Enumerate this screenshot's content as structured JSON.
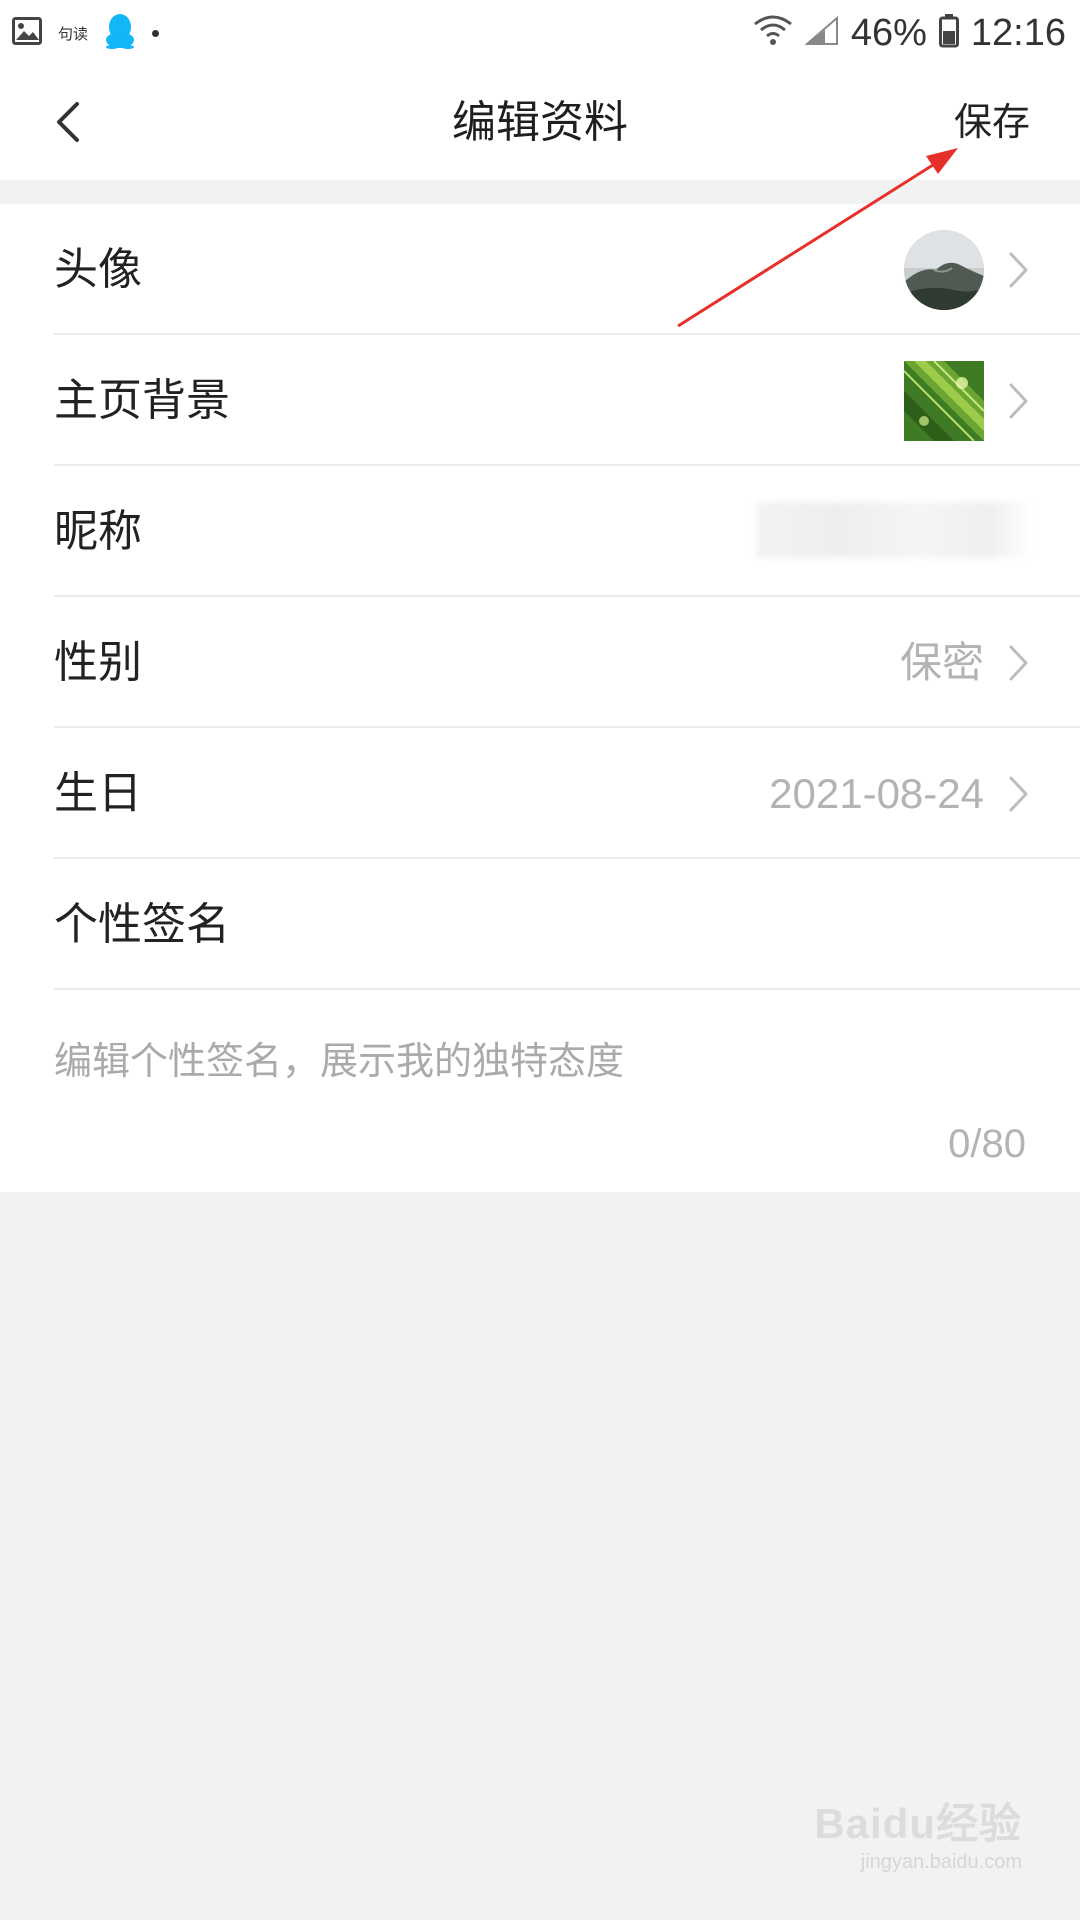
{
  "status_bar": {
    "app_text": "句读",
    "battery": "46%",
    "time": "12:16"
  },
  "header": {
    "title": "编辑资料",
    "save_label": "保存"
  },
  "profile": {
    "rows": [
      {
        "label": "头像"
      },
      {
        "label": "主页背景"
      },
      {
        "label": "昵称",
        "value": ""
      },
      {
        "label": "性别",
        "value": "保密"
      },
      {
        "label": "生日",
        "value": "2021-08-24"
      },
      {
        "label": "个性签名"
      }
    ],
    "signature_placeholder": "编辑个性签名，展示我的独特态度",
    "signature_counter": "0/80"
  },
  "annotation": {
    "color": "#e8302a"
  },
  "watermark": {
    "brand": "Baidu经验",
    "url": "jingyan.baidu.com"
  },
  "colors": {
    "accent_qq": "#12b7f5",
    "value_gray": "#b3b3b3"
  }
}
